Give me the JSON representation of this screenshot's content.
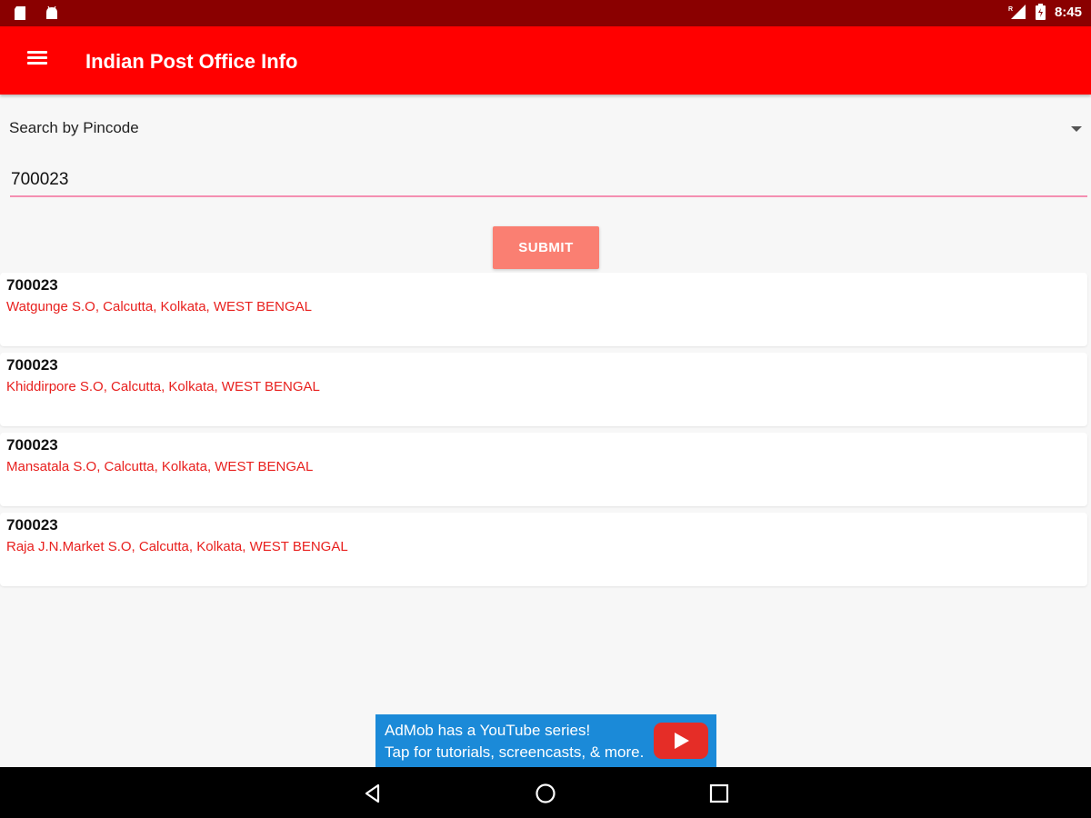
{
  "status_bar": {
    "time": "8:45",
    "left_icons": [
      "sd-card-icon",
      "android-icon"
    ],
    "right_icons": [
      "signal-icon",
      "battery-icon"
    ]
  },
  "app_bar": {
    "title": "Indian Post Office Info",
    "menu_icon": "menu-icon",
    "color": "#ff0000"
  },
  "search": {
    "mode_label": "Search by Pincode",
    "pincode_value": "700023",
    "submit_label": "SUBMIT"
  },
  "results": [
    {
      "pincode": "700023",
      "address": "Watgunge S.O, Calcutta, Kolkata, WEST BENGAL"
    },
    {
      "pincode": "700023",
      "address": "Khiddirpore S.O, Calcutta, Kolkata, WEST BENGAL"
    },
    {
      "pincode": "700023",
      "address": "Mansatala S.O, Calcutta, Kolkata, WEST BENGAL"
    },
    {
      "pincode": "700023",
      "address": "Raja J.N.Market S.O, Calcutta, Kolkata, WEST BENGAL"
    }
  ],
  "ad": {
    "line1": "AdMob has a YouTube series!",
    "line2": "Tap for tutorials, screencasts, & more.",
    "icon": "youtube-play-icon"
  },
  "nav_bar": {
    "buttons": [
      "back-icon",
      "home-icon",
      "recents-icon"
    ]
  },
  "colors": {
    "status_bar": "#8a0000",
    "app_bar": "#ff0000",
    "submit": "#fa7f72",
    "address_text": "#e8201e",
    "input_underline": "#f48fb1",
    "ad_background": "#1b8ad8"
  }
}
